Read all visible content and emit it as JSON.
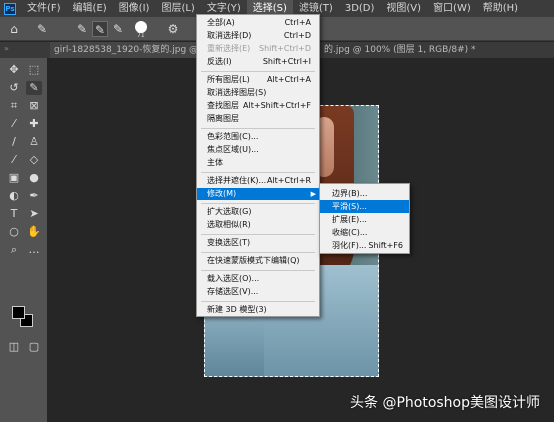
{
  "menubar": {
    "items": [
      "文件(F)",
      "编辑(E)",
      "图像(I)",
      "图层(L)",
      "文字(Y)",
      "选择(S)",
      "滤镜(T)",
      "3D(D)",
      "视图(V)",
      "窗口(W)",
      "帮助(H)"
    ]
  },
  "options": {
    "brush_size": "71"
  },
  "tabs": {
    "doc1": "girl-1828538_1920-恢复的.jpg @ 33.3% (",
    "doc2": "的.jpg @ 100% (图层 1, RGB/8#) *"
  },
  "select_menu": {
    "items": [
      {
        "label": "全部(A)",
        "shortcut": "Ctrl+A"
      },
      {
        "label": "取消选择(D)",
        "shortcut": "Ctrl+D"
      },
      {
        "label": "重新选择(E)",
        "shortcut": "Shift+Ctrl+D"
      },
      {
        "label": "反选(I)",
        "shortcut": "Shift+Ctrl+I"
      },
      {
        "label": "所有图层(L)",
        "shortcut": "Alt+Ctrl+A"
      },
      {
        "label": "取消选择图层(S)",
        "shortcut": ""
      },
      {
        "label": "查找图层",
        "shortcut": "Alt+Shift+Ctrl+F"
      },
      {
        "label": "隔离图层",
        "shortcut": ""
      },
      {
        "label": "色彩范围(C)...",
        "shortcut": ""
      },
      {
        "label": "焦点区域(U)...",
        "shortcut": ""
      },
      {
        "label": "主体",
        "shortcut": ""
      },
      {
        "label": "选择并遮住(K)...",
        "shortcut": "Alt+Ctrl+R"
      },
      {
        "label": "修改(M)",
        "shortcut": ""
      },
      {
        "label": "扩大选取(G)",
        "shortcut": ""
      },
      {
        "label": "选取相似(R)",
        "shortcut": ""
      },
      {
        "label": "变换选区(T)",
        "shortcut": ""
      },
      {
        "label": "在快速蒙版模式下编辑(Q)",
        "shortcut": ""
      },
      {
        "label": "载入选区(O)...",
        "shortcut": ""
      },
      {
        "label": "存储选区(V)...",
        "shortcut": ""
      },
      {
        "label": "新建 3D 模型(3)",
        "shortcut": ""
      }
    ]
  },
  "modify_submenu": {
    "items": [
      {
        "label": "边界(B)...",
        "shortcut": ""
      },
      {
        "label": "平滑(S)...",
        "shortcut": ""
      },
      {
        "label": "扩展(E)...",
        "shortcut": ""
      },
      {
        "label": "收缩(C)...",
        "shortcut": ""
      },
      {
        "label": "羽化(F)...",
        "shortcut": "Shift+F6"
      }
    ]
  },
  "watermark": "头条 @Photoshop美图设计师",
  "colors": {
    "highlight": "#0078d7",
    "menu_bg": "#f0f0f0",
    "app_bg": "#262626",
    "panel": "#535353"
  }
}
